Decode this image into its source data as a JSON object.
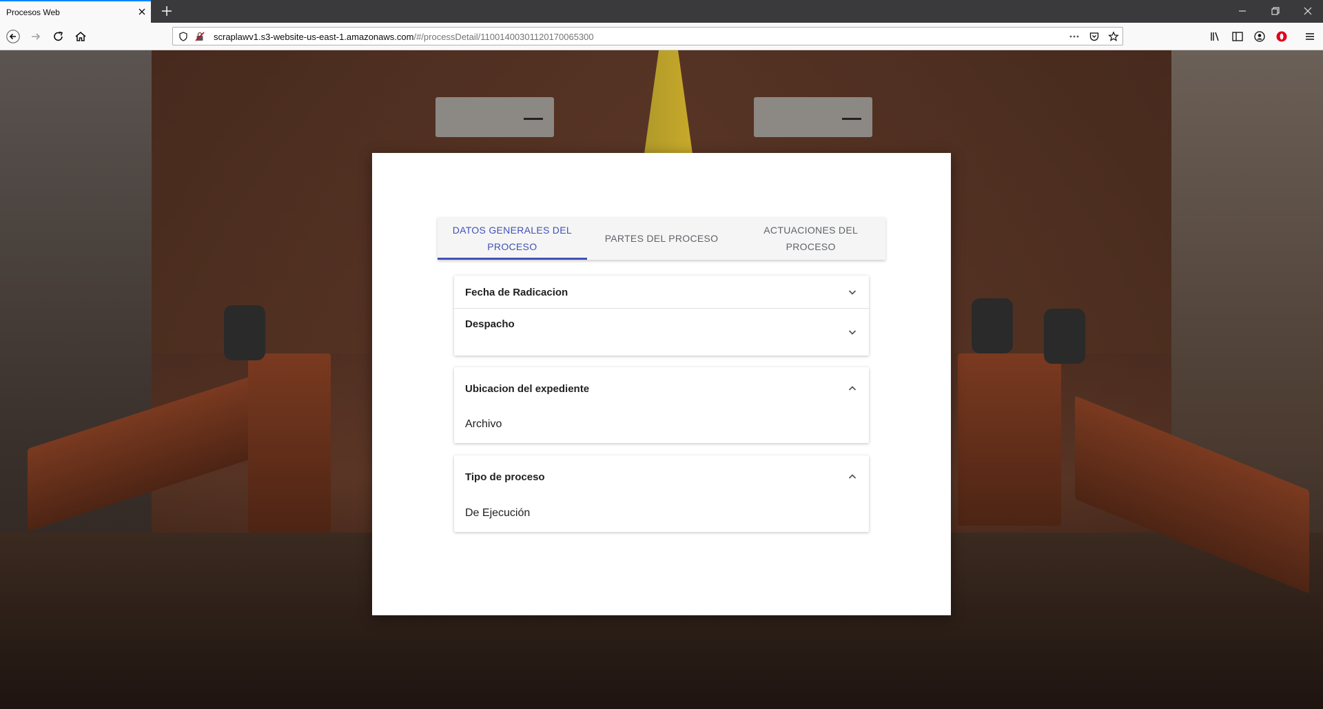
{
  "browser": {
    "tab_title": "Procesos Web",
    "url_host": "scraplawv1.s3-website-us-east-1.amazonaws.com",
    "url_path": "/#/processDetail/11001400301120170065300"
  },
  "page": {
    "tabs": [
      {
        "label": "DATOS GENERALES DEL PROCESO",
        "active": true
      },
      {
        "label": "PARTES DEL PROCESO",
        "active": false
      },
      {
        "label": "ACTUACIONES DEL PROCESO",
        "active": false
      }
    ],
    "panels": {
      "fecha": {
        "title": "Fecha de Radicacion",
        "expanded": false
      },
      "despacho": {
        "title": "Despacho",
        "expanded": false
      },
      "ubicacion": {
        "title": "Ubicacion del expediente",
        "value": "Archivo",
        "expanded": true
      },
      "tipo": {
        "title": "Tipo de proceso",
        "value": "De Ejecución",
        "expanded": true
      }
    }
  },
  "colors": {
    "accent": "#3f51b5",
    "browser_accent": "#0a84ff"
  },
  "icons": [
    "close-icon",
    "plus-icon",
    "minimize-icon",
    "restore-icon",
    "close-window-icon",
    "back-icon",
    "forward-icon",
    "reload-icon",
    "home-icon",
    "shield-icon",
    "insecure-lock-icon",
    "more-icon",
    "pocket-icon",
    "star-icon",
    "library-icon",
    "sidebar-icon",
    "account-icon",
    "opera-icon",
    "menu-icon",
    "chevron-down-icon",
    "chevron-up-icon"
  ]
}
